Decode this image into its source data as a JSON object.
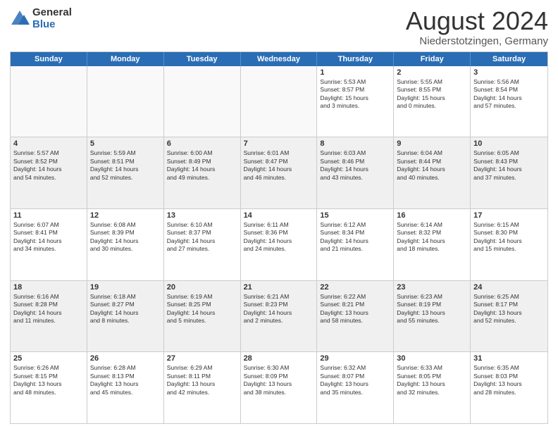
{
  "logo": {
    "general": "General",
    "blue": "Blue"
  },
  "title": "August 2024",
  "location": "Niederstotzingen, Germany",
  "days_of_week": [
    "Sunday",
    "Monday",
    "Tuesday",
    "Wednesday",
    "Thursday",
    "Friday",
    "Saturday"
  ],
  "weeks": [
    [
      {
        "day": "",
        "text": "",
        "empty": true
      },
      {
        "day": "",
        "text": "",
        "empty": true
      },
      {
        "day": "",
        "text": "",
        "empty": true
      },
      {
        "day": "",
        "text": "",
        "empty": true
      },
      {
        "day": "1",
        "text": "Sunrise: 5:53 AM\nSunset: 8:57 PM\nDaylight: 15 hours\nand 3 minutes."
      },
      {
        "day": "2",
        "text": "Sunrise: 5:55 AM\nSunset: 8:55 PM\nDaylight: 15 hours\nand 0 minutes."
      },
      {
        "day": "3",
        "text": "Sunrise: 5:56 AM\nSunset: 8:54 PM\nDaylight: 14 hours\nand 57 minutes."
      }
    ],
    [
      {
        "day": "4",
        "text": "Sunrise: 5:57 AM\nSunset: 8:52 PM\nDaylight: 14 hours\nand 54 minutes."
      },
      {
        "day": "5",
        "text": "Sunrise: 5:59 AM\nSunset: 8:51 PM\nDaylight: 14 hours\nand 52 minutes."
      },
      {
        "day": "6",
        "text": "Sunrise: 6:00 AM\nSunset: 8:49 PM\nDaylight: 14 hours\nand 49 minutes."
      },
      {
        "day": "7",
        "text": "Sunrise: 6:01 AM\nSunset: 8:47 PM\nDaylight: 14 hours\nand 46 minutes."
      },
      {
        "day": "8",
        "text": "Sunrise: 6:03 AM\nSunset: 8:46 PM\nDaylight: 14 hours\nand 43 minutes."
      },
      {
        "day": "9",
        "text": "Sunrise: 6:04 AM\nSunset: 8:44 PM\nDaylight: 14 hours\nand 40 minutes."
      },
      {
        "day": "10",
        "text": "Sunrise: 6:05 AM\nSunset: 8:43 PM\nDaylight: 14 hours\nand 37 minutes."
      }
    ],
    [
      {
        "day": "11",
        "text": "Sunrise: 6:07 AM\nSunset: 8:41 PM\nDaylight: 14 hours\nand 34 minutes."
      },
      {
        "day": "12",
        "text": "Sunrise: 6:08 AM\nSunset: 8:39 PM\nDaylight: 14 hours\nand 30 minutes."
      },
      {
        "day": "13",
        "text": "Sunrise: 6:10 AM\nSunset: 8:37 PM\nDaylight: 14 hours\nand 27 minutes."
      },
      {
        "day": "14",
        "text": "Sunrise: 6:11 AM\nSunset: 8:36 PM\nDaylight: 14 hours\nand 24 minutes."
      },
      {
        "day": "15",
        "text": "Sunrise: 6:12 AM\nSunset: 8:34 PM\nDaylight: 14 hours\nand 21 minutes."
      },
      {
        "day": "16",
        "text": "Sunrise: 6:14 AM\nSunset: 8:32 PM\nDaylight: 14 hours\nand 18 minutes."
      },
      {
        "day": "17",
        "text": "Sunrise: 6:15 AM\nSunset: 8:30 PM\nDaylight: 14 hours\nand 15 minutes."
      }
    ],
    [
      {
        "day": "18",
        "text": "Sunrise: 6:16 AM\nSunset: 8:28 PM\nDaylight: 14 hours\nand 11 minutes."
      },
      {
        "day": "19",
        "text": "Sunrise: 6:18 AM\nSunset: 8:27 PM\nDaylight: 14 hours\nand 8 minutes."
      },
      {
        "day": "20",
        "text": "Sunrise: 6:19 AM\nSunset: 8:25 PM\nDaylight: 14 hours\nand 5 minutes."
      },
      {
        "day": "21",
        "text": "Sunrise: 6:21 AM\nSunset: 8:23 PM\nDaylight: 14 hours\nand 2 minutes."
      },
      {
        "day": "22",
        "text": "Sunrise: 6:22 AM\nSunset: 8:21 PM\nDaylight: 13 hours\nand 58 minutes."
      },
      {
        "day": "23",
        "text": "Sunrise: 6:23 AM\nSunset: 8:19 PM\nDaylight: 13 hours\nand 55 minutes."
      },
      {
        "day": "24",
        "text": "Sunrise: 6:25 AM\nSunset: 8:17 PM\nDaylight: 13 hours\nand 52 minutes."
      }
    ],
    [
      {
        "day": "25",
        "text": "Sunrise: 6:26 AM\nSunset: 8:15 PM\nDaylight: 13 hours\nand 48 minutes."
      },
      {
        "day": "26",
        "text": "Sunrise: 6:28 AM\nSunset: 8:13 PM\nDaylight: 13 hours\nand 45 minutes."
      },
      {
        "day": "27",
        "text": "Sunrise: 6:29 AM\nSunset: 8:11 PM\nDaylight: 13 hours\nand 42 minutes."
      },
      {
        "day": "28",
        "text": "Sunrise: 6:30 AM\nSunset: 8:09 PM\nDaylight: 13 hours\nand 38 minutes."
      },
      {
        "day": "29",
        "text": "Sunrise: 6:32 AM\nSunset: 8:07 PM\nDaylight: 13 hours\nand 35 minutes."
      },
      {
        "day": "30",
        "text": "Sunrise: 6:33 AM\nSunset: 8:05 PM\nDaylight: 13 hours\nand 32 minutes."
      },
      {
        "day": "31",
        "text": "Sunrise: 6:35 AM\nSunset: 8:03 PM\nDaylight: 13 hours\nand 28 minutes."
      }
    ]
  ]
}
